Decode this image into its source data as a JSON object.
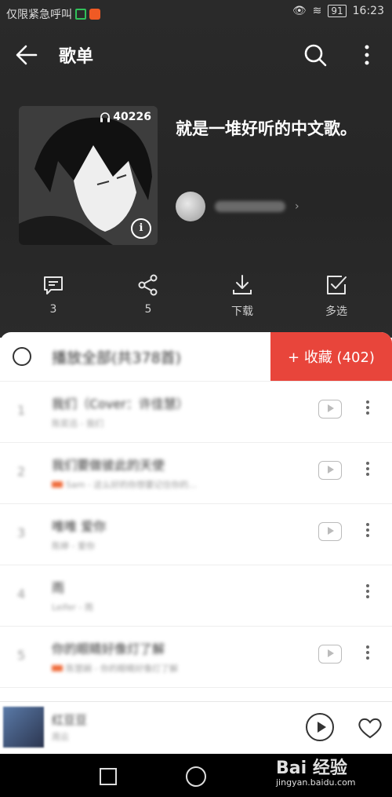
{
  "status_bar": {
    "carrier_text": "仅限紧急呼叫",
    "battery": "91",
    "time": "16:23"
  },
  "toolbar": {
    "title": "歌单",
    "back_icon": "arrow-left-icon",
    "search_icon": "search-icon",
    "more_icon": "more-vertical-icon"
  },
  "playlist": {
    "play_count": "40226",
    "title": "就是一堆好听的中文歌。",
    "creator_name": "",
    "cover_icon": "headphones-icon",
    "info_icon": "info-icon"
  },
  "actions": [
    {
      "icon": "comment-icon",
      "label": "3"
    },
    {
      "icon": "share-icon",
      "label": "5"
    },
    {
      "icon": "download-icon",
      "label": "下载"
    },
    {
      "icon": "multi-select-icon",
      "label": "多选"
    }
  ],
  "list_header": {
    "play_all_label": "播放全部(共378首)",
    "collect_label": "+ 收藏 (402)"
  },
  "songs": [
    {
      "index": "1",
      "title": "我们（Cover：许佳慧）",
      "subtitle": "陈奕迅 - 我们",
      "has_tag": false,
      "has_mv": true
    },
    {
      "index": "2",
      "title": "我们要做彼此的天使",
      "subtitle": "Sam - 这么好的你想要记住你的...",
      "has_tag": true,
      "has_mv": true
    },
    {
      "index": "3",
      "title": "唯唯 爱你",
      "subtitle": "陈婷 - 爱你",
      "has_tag": false,
      "has_mv": true
    },
    {
      "index": "4",
      "title": "雨",
      "subtitle": "Leifer - 雨",
      "has_tag": false,
      "has_mv": false
    },
    {
      "index": "5",
      "title": "你的眼睛好像灯了解",
      "subtitle": "陈慧娴 - 你的眼睛好像灯了解",
      "has_tag": true,
      "has_mv": true
    }
  ],
  "mini_player": {
    "title": "红豆豆",
    "subtitle": "周云"
  },
  "watermark": {
    "brand": "Bai 经验",
    "site": "jingyan.baidu.com"
  },
  "colors": {
    "accent": "#e8453b",
    "header_bg": "#262626"
  }
}
